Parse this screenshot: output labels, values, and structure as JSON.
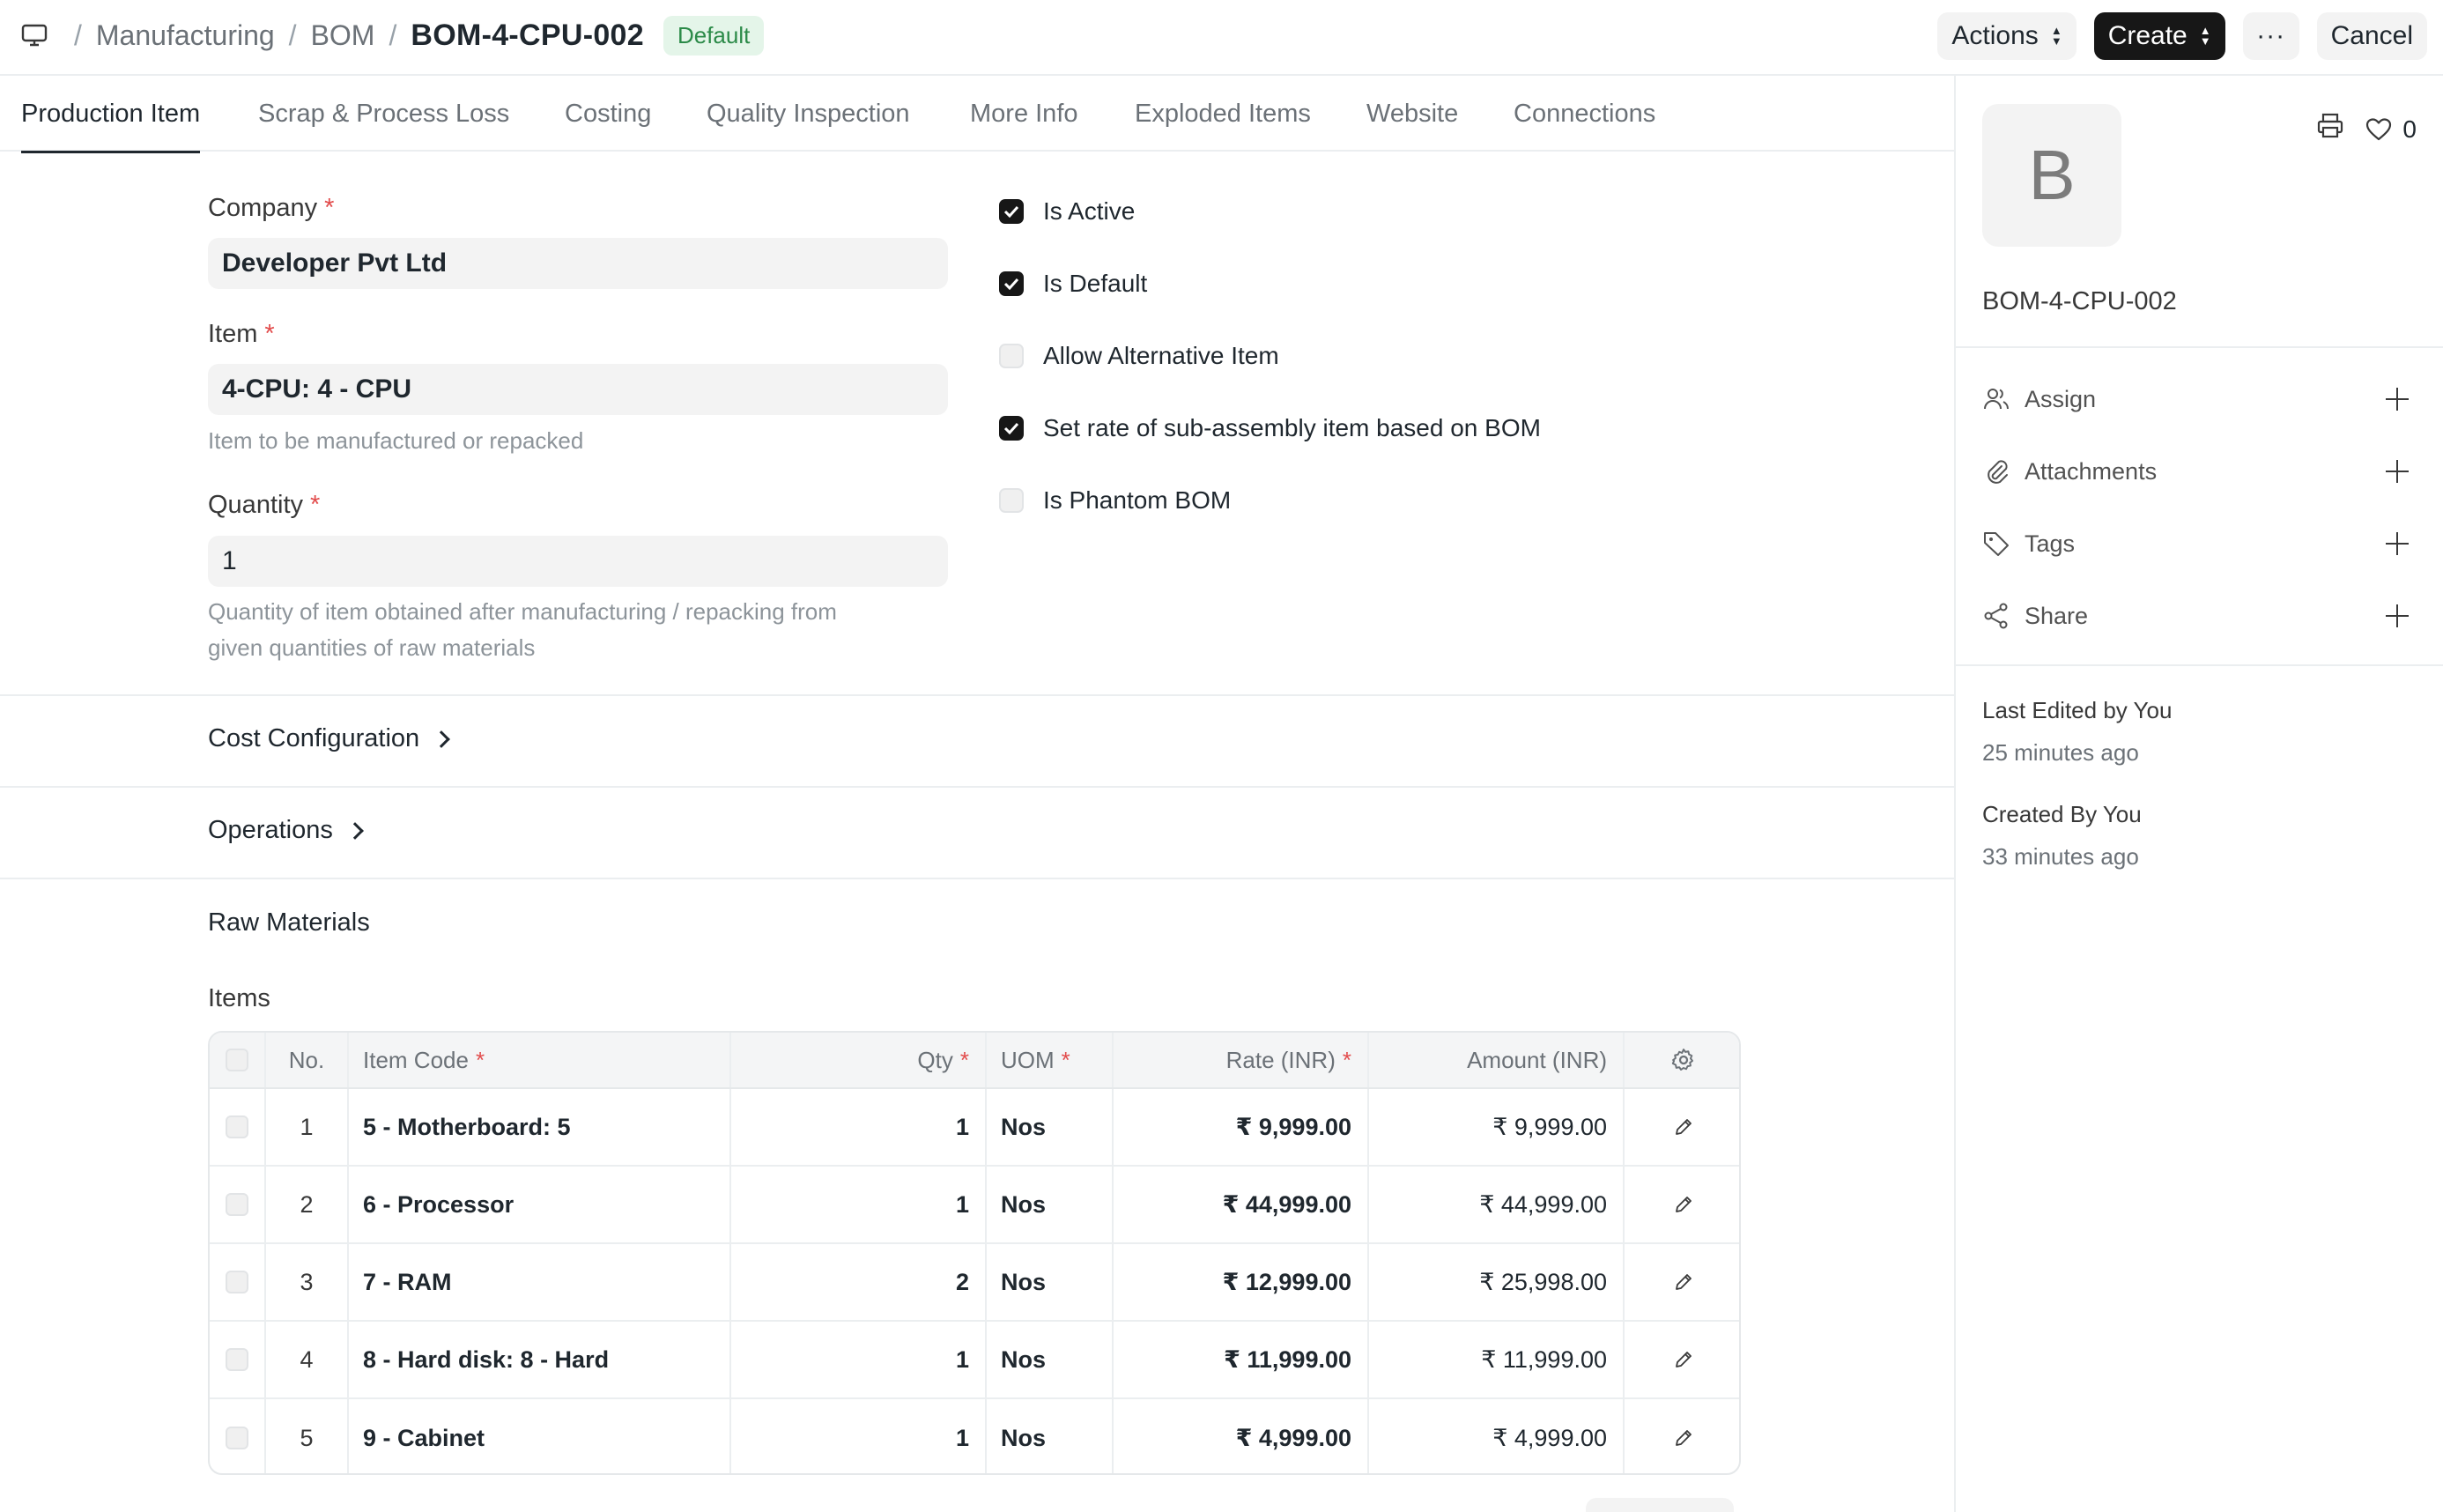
{
  "header": {
    "breadcrumbs": [
      "Manufacturing",
      "BOM"
    ],
    "separator": "/",
    "doc_title": "BOM-4-CPU-002",
    "status_badge": "Default",
    "actions_label": "Actions",
    "create_label": "Create",
    "more_label": "···",
    "cancel_label": "Cancel"
  },
  "tabs": [
    {
      "label": "Production Item",
      "active": true
    },
    {
      "label": "Scrap & Process Loss"
    },
    {
      "label": "Costing"
    },
    {
      "label": "Quality Inspection"
    },
    {
      "label": "More Info"
    },
    {
      "label": "Exploded Items"
    },
    {
      "label": "Website"
    },
    {
      "label": "Connections"
    }
  ],
  "form": {
    "company_label": "Company",
    "company_value": "Developer Pvt Ltd",
    "item_label": "Item",
    "item_value": "4-CPU: 4 - CPU",
    "item_help": "Item to be manufactured or repacked",
    "quantity_label": "Quantity",
    "quantity_value": "1",
    "quantity_help_1": "Quantity of item obtained after manufacturing / repacking from",
    "quantity_help_2": "given quantities of raw materials",
    "required_mark": "*",
    "checkboxes": [
      {
        "label": "Is Active",
        "checked": true
      },
      {
        "label": "Is Default",
        "checked": true
      },
      {
        "label": "Allow Alternative Item",
        "checked": false
      },
      {
        "label": "Set rate of sub-assembly item based on BOM",
        "checked": true
      },
      {
        "label": "Is Phantom BOM",
        "checked": false
      }
    ]
  },
  "sections": {
    "cost_configuration": "Cost Configuration",
    "operations": "Operations",
    "raw_materials": "Raw Materials",
    "items_label": "Items"
  },
  "table": {
    "headers": {
      "no": "No.",
      "item_code": "Item Code",
      "qty": "Qty",
      "uom": "UOM",
      "rate": "Rate (INR)",
      "amount": "Amount (INR)"
    },
    "rows": [
      {
        "no": "1",
        "item_code": "5 - Motherboard: 5",
        "qty": "1",
        "uom": "Nos",
        "rate": "₹ 9,999.00",
        "amount": "₹ 9,999.00"
      },
      {
        "no": "2",
        "item_code": "6 - Processor",
        "qty": "1",
        "uom": "Nos",
        "rate": "₹ 44,999.00",
        "amount": "₹ 44,999.00"
      },
      {
        "no": "3",
        "item_code": "7 - RAM",
        "qty": "2",
        "uom": "Nos",
        "rate": "₹ 12,999.00",
        "amount": "₹ 25,998.00"
      },
      {
        "no": "4",
        "item_code": "8 - Hard disk: 8 - Hard",
        "qty": "1",
        "uom": "Nos",
        "rate": "₹ 11,999.00",
        "amount": "₹ 11,999.00"
      },
      {
        "no": "5",
        "item_code": "9 - Cabinet",
        "qty": "1",
        "uom": "Nos",
        "rate": "₹ 4,999.00",
        "amount": "₹ 4,999.00"
      }
    ]
  },
  "sidebar": {
    "avatar_letter": "B",
    "likes_count": "0",
    "doc_name": "BOM-4-CPU-002",
    "items": [
      {
        "label": "Assign",
        "icon": "user-group-icon"
      },
      {
        "label": "Attachments",
        "icon": "paperclip-icon"
      },
      {
        "label": "Tags",
        "icon": "tag-icon"
      },
      {
        "label": "Share",
        "icon": "share-icon"
      }
    ],
    "last_edited_label": "Last Edited by You",
    "last_edited_time": "25 minutes ago",
    "created_label": "Created By You",
    "created_time": "33 minutes ago"
  },
  "colors": {
    "accent_dark": "#171717",
    "badge_green_bg": "#e4f5e9",
    "badge_green_text": "#2b8a48",
    "required_red": "#e24c4c"
  }
}
